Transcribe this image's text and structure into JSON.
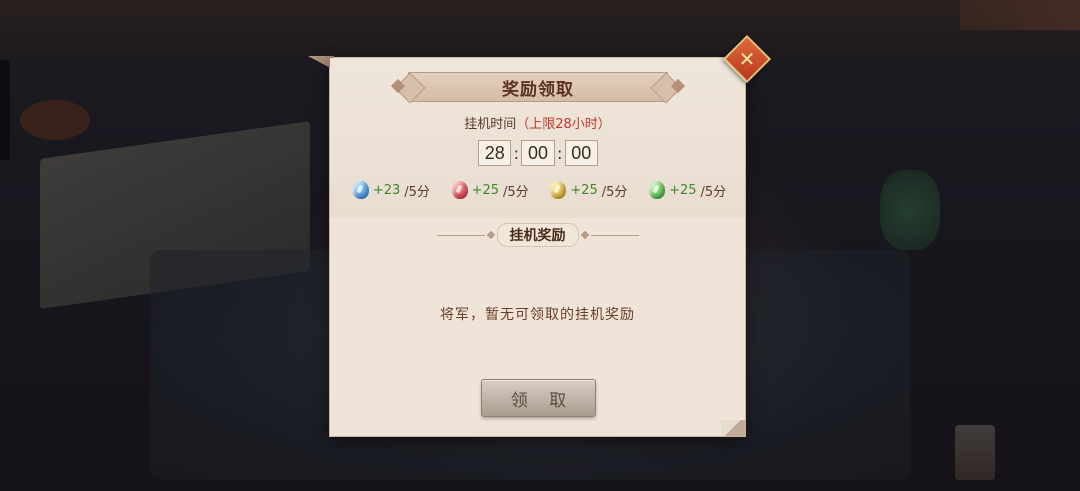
{
  "dialog": {
    "title": "奖励领取",
    "idle_time_label": "挂机时间",
    "idle_time_limit": "（上限28小时）",
    "timer": {
      "hours": "28",
      "minutes": "00",
      "seconds": "00"
    },
    "rates": [
      {
        "icon": "blue-gem-icon",
        "value": "+23",
        "unit": "/5分"
      },
      {
        "icon": "red-gem-icon",
        "value": "+25",
        "unit": "/5分"
      },
      {
        "icon": "yellow-gem-icon",
        "value": "+25",
        "unit": "/5分"
      },
      {
        "icon": "green-gem-icon",
        "value": "+25",
        "unit": "/5分"
      }
    ],
    "section_title": "挂机奖励",
    "empty_message": "将军，暂无可领取的挂机奖励",
    "claim_button": "领 取",
    "colors": {
      "accent_red": "#c0392b",
      "rate_green": "#3f8a2a",
      "close_orange": "#d04a2a"
    }
  }
}
